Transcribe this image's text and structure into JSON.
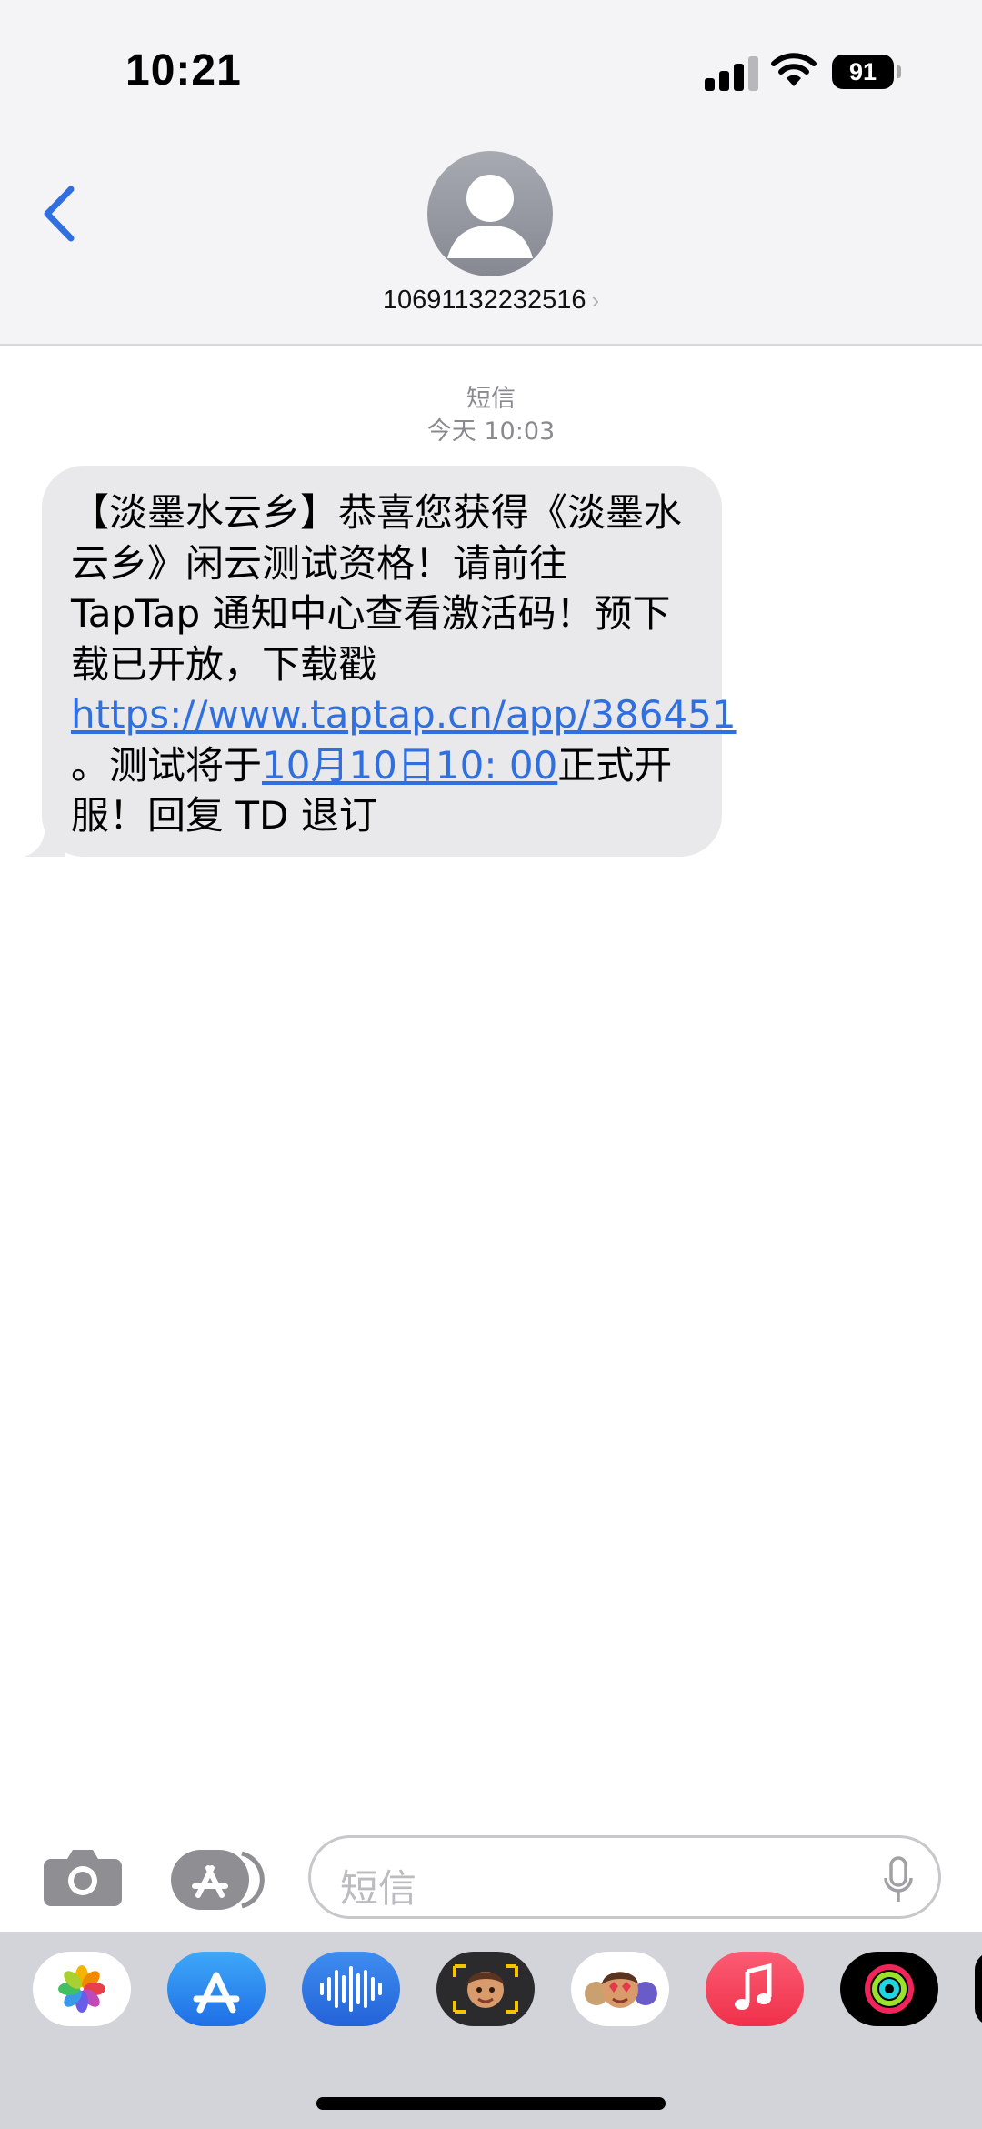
{
  "status_bar": {
    "time": "10:21",
    "battery": "91"
  },
  "header": {
    "contact": "10691132232516",
    "chevron": "›"
  },
  "thread": {
    "service": "短信",
    "timestamp": "今天 10:03",
    "message": {
      "text_1": "【淡墨水云乡】恭喜您获得《淡墨水云乡》闲云测试资格！请前往 TapTap 通知中心查看激活码！预下载已开放，下载戳 ",
      "link_1": "https://www.taptap.cn/app/386451",
      "text_2": " 。测试将于",
      "link_2": "10月10日10: 00",
      "text_3": "正式开服！回复 TD 退订"
    }
  },
  "composer": {
    "placeholder": "短信"
  },
  "colors": {
    "accent": "#2f6fe0",
    "bubble": "#e9e9eb",
    "header_bg": "#f4f4f6"
  },
  "app_drawer": [
    {
      "name": "photos-icon"
    },
    {
      "name": "app-store-icon"
    },
    {
      "name": "audio-message-icon"
    },
    {
      "name": "memoji-camera-icon"
    },
    {
      "name": "memoji-stickers-icon"
    },
    {
      "name": "music-icon"
    },
    {
      "name": "activity-icon"
    }
  ]
}
